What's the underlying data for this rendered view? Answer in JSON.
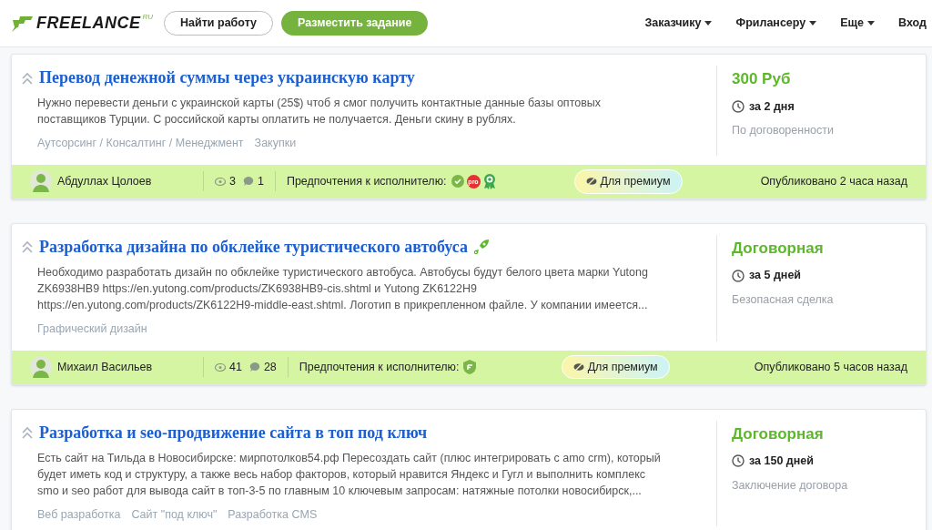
{
  "header": {
    "logo": "FREELANCE",
    "logo_suffix": "RU",
    "find_work": "Найти работу",
    "post_task": "Разместить задание",
    "nav": [
      {
        "label": "Заказчику",
        "dropdown": true
      },
      {
        "label": "Фрилансеру",
        "dropdown": true
      },
      {
        "label": "Еще",
        "dropdown": true
      },
      {
        "label": "Вход",
        "dropdown": false
      }
    ]
  },
  "projects": [
    {
      "title": "Перевод денежной суммы через украинскую карту",
      "boosted": false,
      "description": [
        "Нужно перевести деньги с украинской карты (25$) чтоб я смог получить контактные данные базы оптовых",
        "поставщиков Турции. С российской карты оплатить не получается. Деньги скину в рублях."
      ],
      "tags": [
        "Аутсорсинг / Консалтинг / Менеджмент",
        "Закупки"
      ],
      "price": "300 Руб",
      "term": "за 2 дня",
      "payment": "По договоренности",
      "footer": {
        "author": "Абдуллах Цолоев",
        "views": "3",
        "comments": "1",
        "preferences_label": "Предпочтения к исполнителю:",
        "preferences": [
          {
            "kind": "verified"
          },
          {
            "kind": "pro",
            "label": "pro"
          },
          {
            "kind": "award"
          }
        ],
        "premium": "Для премиум",
        "published": "Опубликовано 2 часа назад"
      }
    },
    {
      "title": "Разработка дизайна по обклейке туристического автобуса",
      "boosted": true,
      "description": [
        "Необходимо разработать дизайн по обклейке туристического автобуса. Автобусы будут белого цвета марки Yutong",
        "ZK6938HB9 https://en.yutong.com/products/ZK6938HB9-cis.shtml и Yutong ZK6122H9",
        "https://en.yutong.com/products/ZK6122H9-middle-east.shtml. Логотип в прикрепленном файле. У компании имеется..."
      ],
      "tags": [
        "Графический дизайн"
      ],
      "price": "Договорная",
      "term": "за 5 дней",
      "payment": "Безопасная сделка",
      "footer": {
        "author": "Михаил Васильев",
        "views": "41",
        "comments": "28",
        "preferences_label": "Предпочтения к исполнителю:",
        "preferences": [
          {
            "kind": "safe"
          }
        ],
        "premium": "Для премиум",
        "published": "Опубликовано 5 часов назад"
      }
    },
    {
      "title": "Разработка и seo-продвижение сайта в топ под ключ",
      "boosted": false,
      "description": [
        "Есть сайт на Тильда в Новосибирске: мирпотолков54.рф Пересоздать сайт (плюс интегрировать с amo crm), который",
        "будет иметь код и структуру, а также весь набор факторов, который нравится Яндекс и Гугл и выполнить комплекс",
        "smo и seo работ для вывода сайт в топ-3-5 по главным 10 ключевым запросам: натяжные потолки новосибирск,..."
      ],
      "tags": [
        "Веб разработка",
        "Сайт \"под ключ\"",
        "Разработка CMS"
      ],
      "price": "Договорная",
      "term": "за 150 дней",
      "payment": "Заключение договора"
    }
  ]
}
